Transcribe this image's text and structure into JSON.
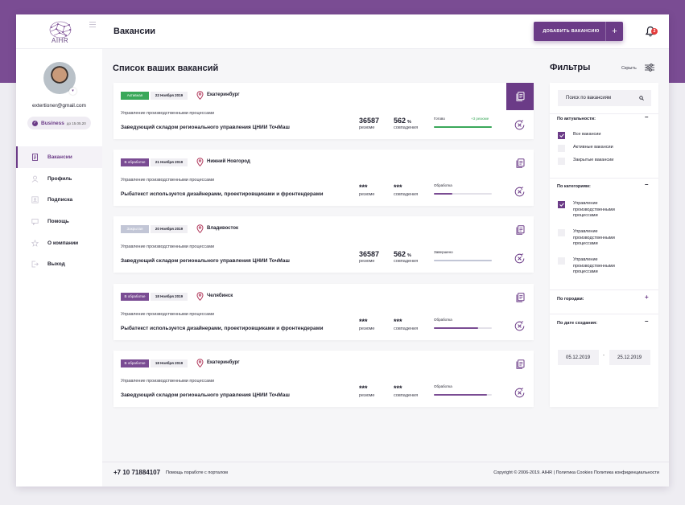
{
  "header": {
    "logo_text": "AIHR",
    "page_title": "Вакансии",
    "add_button_label": "ДОБАВИТЬ ВАКАНСИЮ",
    "add_button_icon": "+",
    "notification_count": "2"
  },
  "sidebar": {
    "email": "extertioner@gmail.com",
    "plan_name": "Business",
    "plan_until": "до 15.05.20",
    "items": [
      {
        "label": "Вакансии",
        "icon": "document-icon"
      },
      {
        "label": "Профиль",
        "icon": "user-icon"
      },
      {
        "label": "Подписка",
        "icon": "id-card-icon"
      },
      {
        "label": "Помощь",
        "icon": "chat-icon"
      },
      {
        "label": "О компании",
        "icon": "star-icon"
      },
      {
        "label": "Выход",
        "icon": "logout-icon"
      }
    ]
  },
  "main": {
    "title": "Список ваших вакансий",
    "resume_label": "резюме",
    "match_label": "совпадения",
    "vacancies": [
      {
        "status": "Активная",
        "status_color": "#3aa85a",
        "date": "22 Ноября 2019",
        "city": "Екатеринбург",
        "category": "Управление производственными процессами",
        "title": "Заведующий складом регионального управления ЦНИИ ТочМаш",
        "resumes": "36587",
        "match": "562",
        "match_unit": "%",
        "progress_label": "Готово",
        "progress_extra": "+3 резюме",
        "progress": 1.0,
        "progress_color": "#3aa85a"
      },
      {
        "status": "В обработке",
        "status_color": "#7a4c93",
        "date": "21 Ноября 2019",
        "city": "Нижний Новгород",
        "category": "Управление производственными процессами",
        "title": "Рыбатекст используется дизайнерами, проектировщиками и фронтендерами",
        "resumes": "***",
        "match": "***",
        "match_unit": "",
        "progress_label": "Обработка",
        "progress_extra": "",
        "progress": 0.32,
        "progress_color": "#7a4c93"
      },
      {
        "status": "Закрытая",
        "status_color": "#c2c6d6",
        "date": "20 Ноября 2019",
        "city": "Владивосток",
        "category": "Управление производственными процессами",
        "title": "Заведующий складом регионального управления ЦНИИ ТочМаш",
        "resumes": "36587",
        "match": "562",
        "match_unit": "%",
        "progress_label": "Завершено",
        "progress_extra": "",
        "progress": 1.0,
        "progress_color": "#c2c6d6"
      },
      {
        "status": "В обработке",
        "status_color": "#7a4c93",
        "date": "18 Ноября 2019",
        "city": "Челябинск",
        "category": "Управление производственными процессами",
        "title": "Рыбатекст используется дизайнерами, проектировщиками и фронтендерами",
        "resumes": "***",
        "match": "***",
        "match_unit": "",
        "progress_label": "Обработка",
        "progress_extra": "",
        "progress": 0.76,
        "progress_color": "#7a4c93"
      },
      {
        "status": "В обработке",
        "status_color": "#7a4c93",
        "date": "18 Ноября 2019",
        "city": "Екатеринбург",
        "category": "Управление производственными процессами",
        "title": "Заведующий складом регионального управления ЦНИИ ТочМаш",
        "resumes": "***",
        "match": "***",
        "match_unit": "",
        "progress_label": "Обработка",
        "progress_extra": "",
        "progress": 0.92,
        "progress_color": "#7a4c93"
      }
    ]
  },
  "filters": {
    "title": "Фильтры",
    "hide_label": "Скрыть",
    "search_placeholder": "Поиск по вакансиям",
    "relevance": {
      "title": "По актуальности:",
      "options": [
        {
          "label": "Все вакансии",
          "checked": true
        },
        {
          "label": "Активные вакансии",
          "checked": false
        },
        {
          "label": "Закрытые вакансии",
          "checked": false
        }
      ]
    },
    "categories": {
      "title": "По категориям:",
      "options": [
        {
          "label": "Управление производственными процессами",
          "checked": true
        },
        {
          "label": "Управление производственными процессами",
          "checked": false
        },
        {
          "label": "Управление производственными процессами",
          "checked": false
        }
      ]
    },
    "cities_title": "По городам:",
    "date_title": "По дате создания:",
    "date_from": "05.12.2019",
    "date_sep": "-",
    "date_to": "25.12.2019"
  },
  "footer": {
    "phone": "+7 10 71884107",
    "help": "Помощь порaботе с порталом",
    "copyright": "Copyright © 2006-2019. AIHR  |  Политика Cookies Политика конфиденциальности"
  },
  "colors": {
    "accent": "#6b3b87",
    "header_purple": "#7a4c93",
    "success": "#3aa85a"
  }
}
